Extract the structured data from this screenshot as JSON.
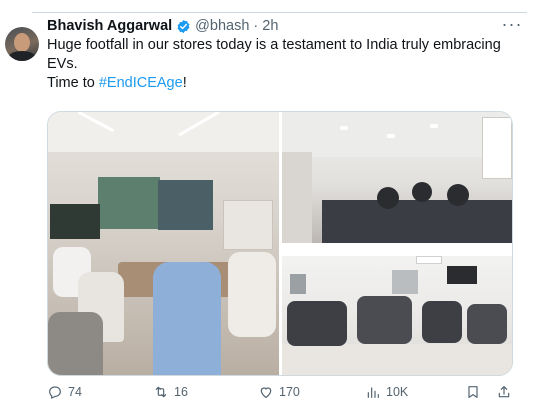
{
  "tweet": {
    "author_name": "Bhavish Aggarwal",
    "handle": "@bhash",
    "separator": "·",
    "time": "2h",
    "line1": "Huge footfall in our stores today is a testament to India truly embracing EVs.",
    "line2_prefix": "Time to ",
    "hashtag": "#EndICEAge",
    "line2_suffix": "!"
  },
  "media": {
    "images": [
      {
        "label": "store-interior-customers-left"
      },
      {
        "label": "store-interior-customers-top-right"
      },
      {
        "label": "store-interior-customers-bottom-right"
      }
    ]
  },
  "actions": {
    "replies": "74",
    "reposts": "16",
    "likes": "170",
    "views": "10K"
  },
  "colors": {
    "accent": "#1d9bf0",
    "secondary_text": "#536471",
    "primary_text": "#0f1419"
  },
  "icons": [
    "verified-badge-icon",
    "more-options-icon",
    "reply-icon",
    "repost-icon",
    "like-icon",
    "views-icon",
    "bookmark-icon",
    "share-icon"
  ]
}
